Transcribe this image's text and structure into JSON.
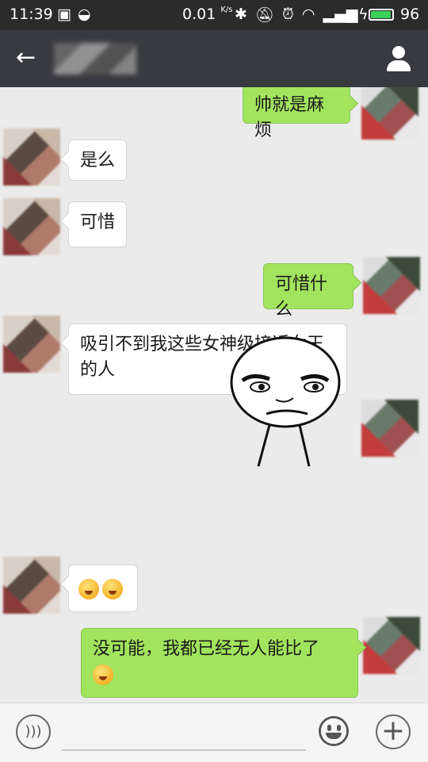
{
  "status_bar": {
    "time": "11:39",
    "net_speed": "0.01",
    "net_unit": "K/s",
    "battery_percent": "96",
    "battery_level": 0.96,
    "icons": [
      "image-icon",
      "data-saver-icon",
      "bluetooth-icon",
      "mute-icon",
      "alarm-icon",
      "wifi-icon",
      "signal-3g-icon",
      "charging-icon"
    ]
  },
  "title_bar": {
    "back_icon": "←",
    "contact_icon": "person-icon"
  },
  "messages": [
    {
      "side": "right",
      "text": "帅就是麻烦"
    },
    {
      "side": "left",
      "text": "是么"
    },
    {
      "side": "left",
      "text": "可惜"
    },
    {
      "side": "right",
      "text": "可惜什么"
    },
    {
      "side": "left",
      "text": "吸引不到我这些女神级接近女王的人"
    },
    {
      "side": "right",
      "type": "sticker",
      "sticker": "meme-face"
    },
    {
      "side": "left",
      "type": "emoji",
      "emoji": [
        "smirk-emoji",
        "smirk-emoji"
      ]
    },
    {
      "side": "right",
      "text": "没可能，我都已经无人能比了",
      "trailing_emoji": "grin-emoji"
    }
  ],
  "input_bar": {
    "voice_icon": "voice-icon",
    "emoji_icon": "emoji-icon",
    "plus_icon": "+"
  },
  "colors": {
    "status_bar_bg": "#2b2b2b",
    "title_bar_bg": "#393a3f",
    "chat_bg": "#ebebeb",
    "bubble_right": "#a2e45e",
    "bubble_left": "#ffffff",
    "battery_fill": "#3bd15b"
  }
}
